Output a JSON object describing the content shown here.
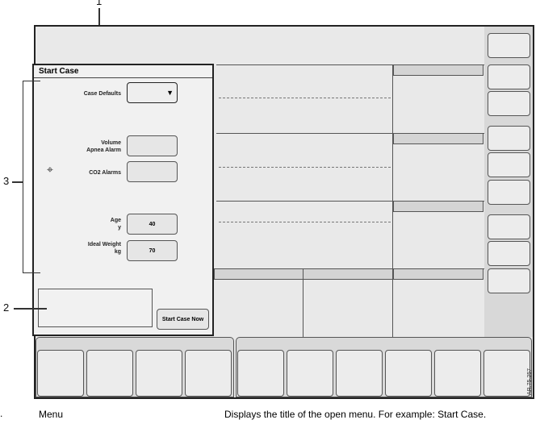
{
  "menu": {
    "title": "Start Case",
    "case_defaults_label": "Case Defaults",
    "volume_apnea_label": "Volume Apnea Alarm",
    "co2_alarms_label": "CO2 Alarms",
    "age_label": "Age",
    "age_unit": "y",
    "age_value": "40",
    "weight_label": "Ideal Weight",
    "weight_unit": "kg",
    "weight_value": "70",
    "start_button": "Start Case Now"
  },
  "callouts": {
    "c1": "1",
    "c2": "2",
    "c3": "3"
  },
  "caption": {
    "bullet": ".",
    "term": "Menu",
    "description": "Displays the title of the open menu. For example: Start Case."
  },
  "figure_id": "AR.75.257"
}
